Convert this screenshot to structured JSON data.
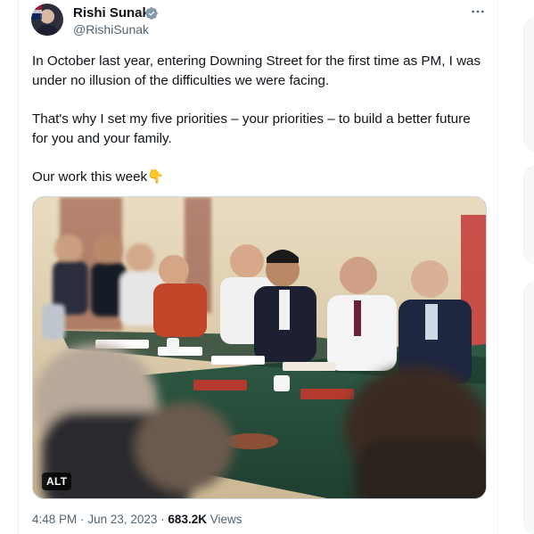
{
  "author": {
    "display_name": "Rishi Sunak",
    "handle": "@RishiSunak",
    "verified_icon": "verified-badge-icon",
    "avatar_icon": "avatar"
  },
  "more_icon": "more-horizontal-icon",
  "tweet": {
    "paragraphs": [
      "In October last year, entering Downing Street for the first time as PM, I was under no illusion of the difficulties we were facing.",
      "That's why I set my five priorities – your priorities – to build a better future for you and your family.",
      "Our work this week👇"
    ]
  },
  "media": {
    "alt_label": "ALT"
  },
  "meta": {
    "time": "4:48 PM",
    "date": "Jun 23, 2023",
    "separator": "·",
    "views_count": "683.2K",
    "views_label": "Views"
  },
  "colors": {
    "text_primary": "#0f1419",
    "text_secondary": "#536471",
    "verified": "#829aab",
    "border": "#eff3f4"
  }
}
